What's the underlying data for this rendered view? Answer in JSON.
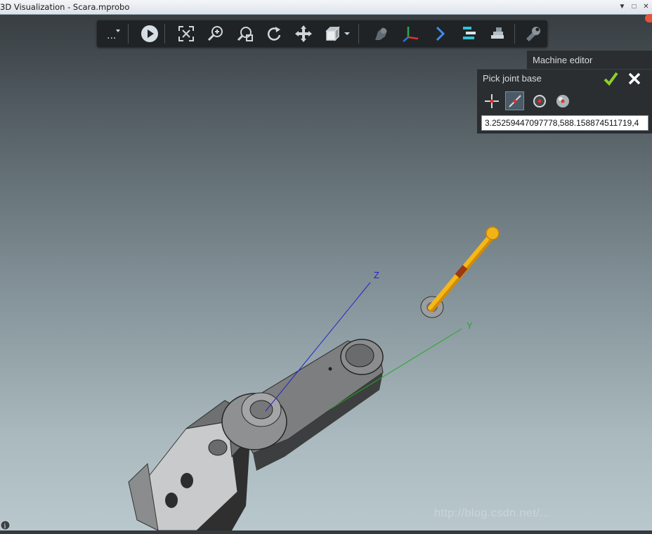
{
  "window": {
    "title": "3D Visualization - Scara.mprobo",
    "controls": [
      "▼",
      "□",
      "✕"
    ]
  },
  "toolbar": {
    "icons": [
      "more-menu-icon",
      "play-icon",
      "zoom-extents-icon",
      "zoom-in-icon",
      "zoom-window-icon",
      "rotate-icon",
      "pan-icon",
      "view-cube-icon",
      "dropdown-arrow-icon",
      "machine-icon",
      "axes-icon",
      "next-icon",
      "align-icon",
      "tool-icon",
      "settings-wrench-icon"
    ],
    "more_label": "..."
  },
  "machine_editor": {
    "label": "Machine editor"
  },
  "pick_panel": {
    "title": "Pick joint base",
    "coordinate_value": "3.25259447097778,588.158874511719,4",
    "modes": [
      "crosshair-icon",
      "line-icon",
      "circle-center-icon",
      "sphere-center-icon"
    ],
    "active_mode": "line-icon"
  },
  "scene": {
    "axis_labels": {
      "z": "Z",
      "y": "Y"
    },
    "axis_colors": {
      "z": "#2222cc",
      "y": "#22aa22"
    }
  },
  "watermark": "http://blog.csdn.net/..."
}
